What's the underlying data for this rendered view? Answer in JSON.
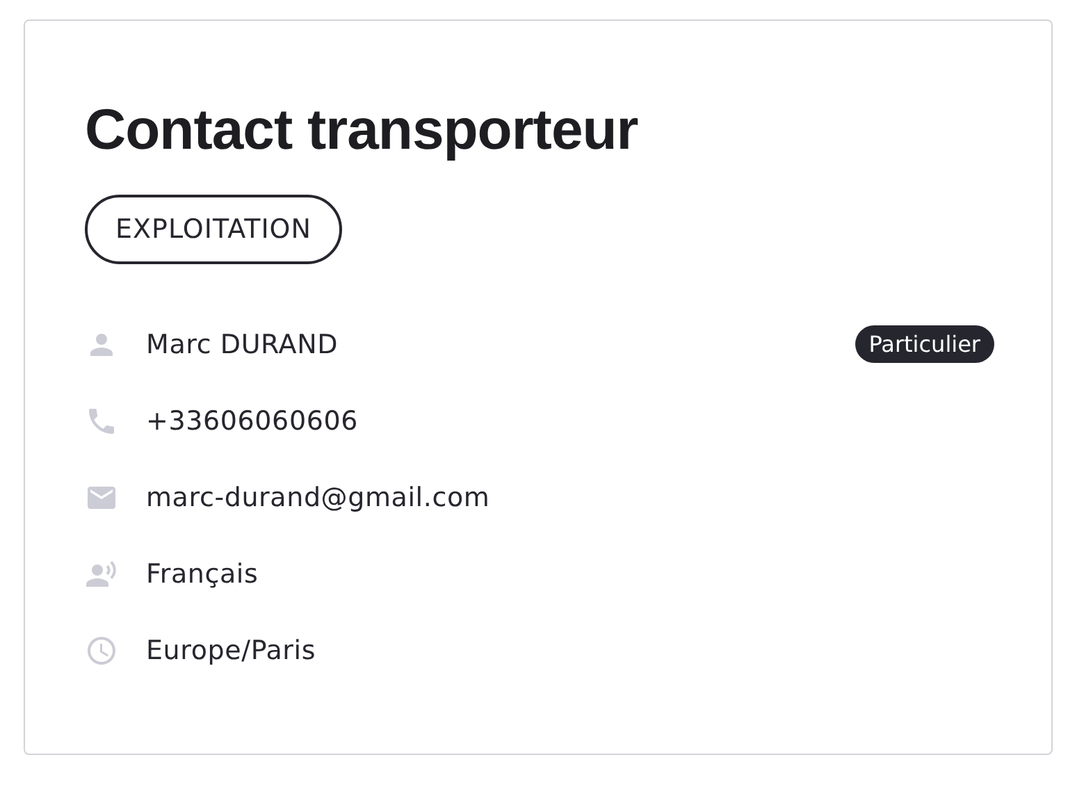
{
  "card": {
    "title": "Contact transporteur",
    "tag": "EXPLOITATION",
    "rows": [
      {
        "kind": "person",
        "text": "Marc DURAND",
        "badge": "Particulier"
      },
      {
        "kind": "phone",
        "text": "+33606060606"
      },
      {
        "kind": "email",
        "text": "marc-durand@gmail.com"
      },
      {
        "kind": "language",
        "text": "Français"
      },
      {
        "kind": "timezone",
        "text": "Europe/Paris"
      }
    ]
  }
}
